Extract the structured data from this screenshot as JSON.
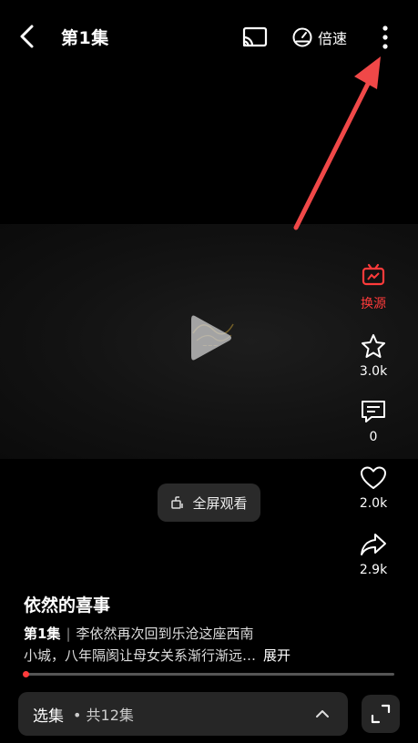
{
  "header": {
    "title": "第1集",
    "speed_label": "倍速"
  },
  "rail": {
    "source_label": "换源",
    "favorite_count": "3.0k",
    "comment_count": "0",
    "like_count": "2.0k",
    "share_count": "2.9k"
  },
  "fullscreen": {
    "label": "全屏观看"
  },
  "show": {
    "title": "依然的喜事",
    "episode": "第1集",
    "description_line1": "李依然再次回到乐沧这座西南",
    "description_line2": "小城，八年隔阂让母女关系渐行渐远…",
    "expand_label": "展开"
  },
  "progress": {
    "fraction": 0.01
  },
  "episodes": {
    "select_label": "选集",
    "count_label": "• 共12集"
  },
  "colors": {
    "accent": "#ff3b3b",
    "panel": "#262626"
  },
  "icons": [
    "back-icon",
    "cast-icon",
    "speed-icon",
    "more-icon",
    "play-icon",
    "switch-source-icon",
    "star-icon",
    "comment-icon",
    "heart-icon",
    "share-icon",
    "fullscreen-icon",
    "chevron-up-icon",
    "expand-icon"
  ]
}
